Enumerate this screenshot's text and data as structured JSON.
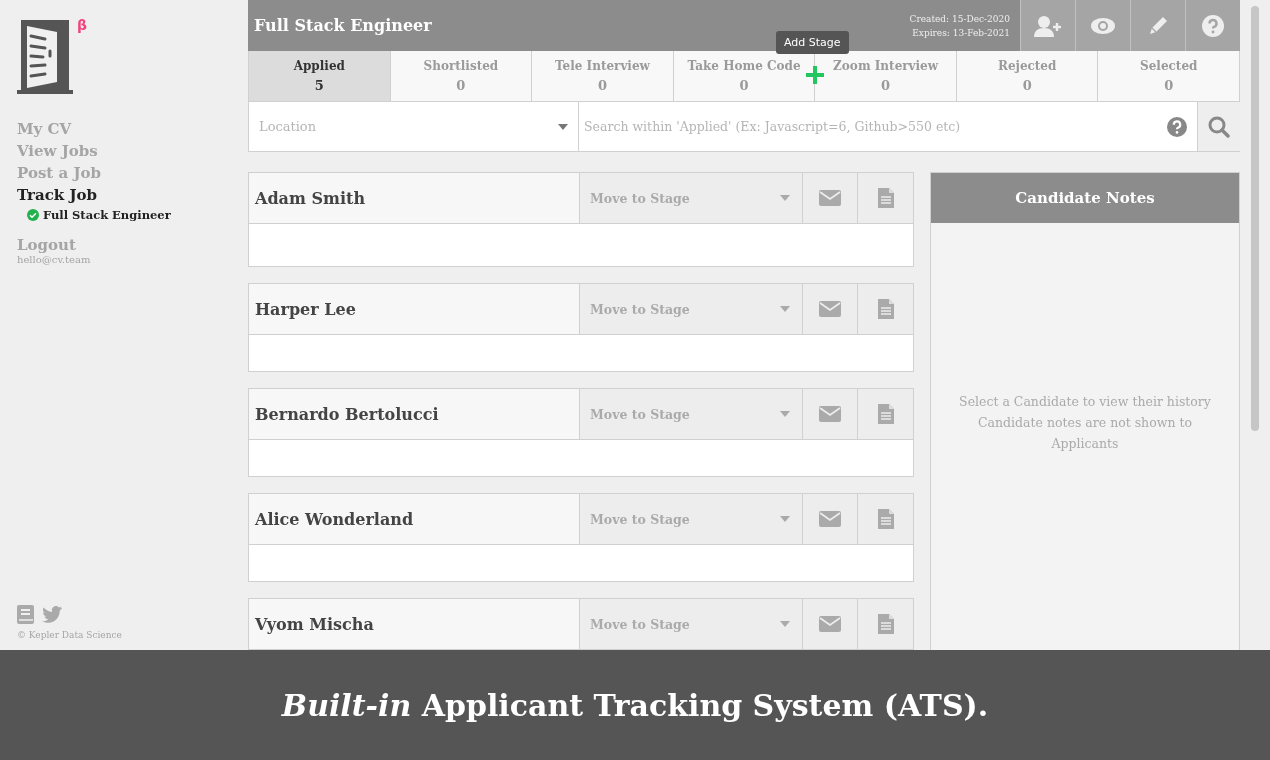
{
  "sidebar": {
    "nav": [
      {
        "label": "My CV",
        "selected": false
      },
      {
        "label": "View Jobs",
        "selected": false
      },
      {
        "label": "Post a Job",
        "selected": false
      },
      {
        "label": "Track Job",
        "selected": true
      }
    ],
    "sub_item": {
      "label": "Full Stack Engineer"
    },
    "logout": "Logout",
    "email": "hello@cv.team",
    "badge": "β",
    "footer": "© Kepler Data Science"
  },
  "job": {
    "title": "Full Stack Engineer",
    "created": "Created: 15-Dec-2020",
    "expires": "Expires: 13-Feb-2021"
  },
  "stages": [
    {
      "label": "Applied",
      "count": "5",
      "selected": true
    },
    {
      "label": "Shortlisted",
      "count": "0",
      "selected": false
    },
    {
      "label": "Tele Interview",
      "count": "0",
      "selected": false
    },
    {
      "label": "Take Home Code",
      "count": "0",
      "selected": false
    },
    {
      "label": "Zoom Interview",
      "count": "0",
      "selected": false
    },
    {
      "label": "Rejected",
      "count": "0",
      "selected": false
    },
    {
      "label": "Selected",
      "count": "0",
      "selected": false
    }
  ],
  "tooltip": "Add Stage",
  "filters": {
    "location_placeholder": "Location",
    "search_placeholder": "Search within 'Applied' (Ex: Javascript=6, Github>550 etc)"
  },
  "candidates": [
    {
      "name": "Adam Smith",
      "stage_placeholder": "Move to Stage"
    },
    {
      "name": "Harper Lee",
      "stage_placeholder": "Move to Stage"
    },
    {
      "name": "Bernardo Bertolucci",
      "stage_placeholder": "Move to Stage"
    },
    {
      "name": "Alice Wonderland",
      "stage_placeholder": "Move to Stage"
    },
    {
      "name": "Vyom Mischa",
      "stage_placeholder": "Move to Stage"
    }
  ],
  "notes": {
    "title": "Candidate Notes",
    "lines": [
      "Select a Candidate to view their history",
      "Candidate notes are not shown to Applicants"
    ]
  },
  "caption": "*Built-in* Applicant Tracking System (ATS)."
}
